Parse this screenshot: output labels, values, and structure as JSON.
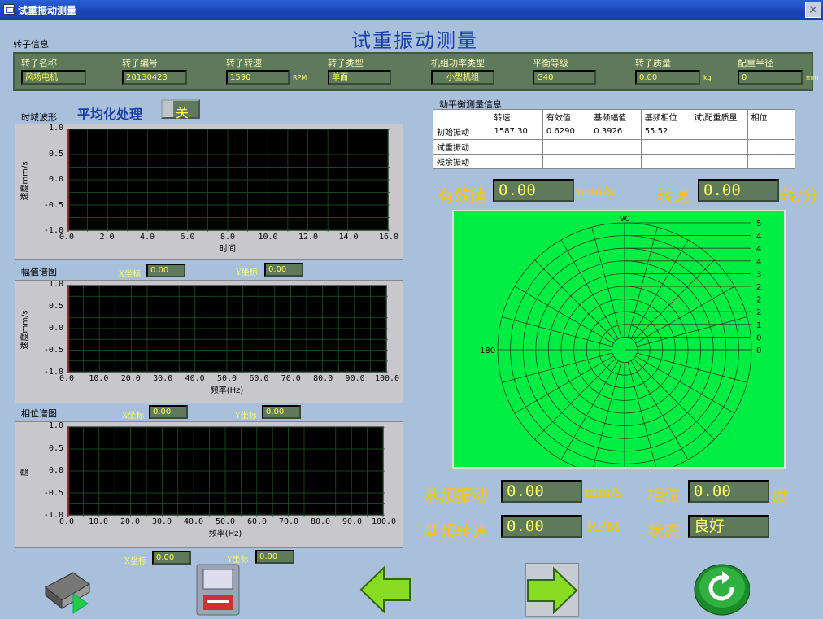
{
  "window": {
    "title": "试重振动测量"
  },
  "header": {
    "title": "试重振动测量",
    "section_label": "转子信息"
  },
  "rotor_info": [
    {
      "label": "转子名称",
      "value": "风场电机",
      "unit": ""
    },
    {
      "label": "转子编号",
      "value": "20130423",
      "unit": ""
    },
    {
      "label": "转子转速",
      "value": "1590",
      "unit": "RPM"
    },
    {
      "label": "转子类型",
      "value": "单面",
      "unit": ""
    },
    {
      "label": "机组功率类型",
      "value": "小型机组",
      "unit": ""
    },
    {
      "label": "平衡等级",
      "value": "G40",
      "unit": ""
    },
    {
      "label": "转子质量",
      "value": "0.00",
      "unit": "kg"
    },
    {
      "label": "配重半径",
      "value": "0",
      "unit": "mm"
    }
  ],
  "averaging": {
    "label": "平均化处理",
    "value": "关"
  },
  "time_chart": {
    "title": "时域波形",
    "ylabel": "速度mm/s",
    "xlabel": "时间",
    "yticks": [
      "1.0",
      "0.5",
      "0.0",
      "-0.5",
      "-1.0"
    ],
    "xticks": [
      "0.0",
      "2.0",
      "4.0",
      "6.0",
      "8.0",
      "10.0",
      "12.0",
      "14.0",
      "16.0"
    ]
  },
  "amp_chart": {
    "title": "幅值谱图",
    "ylabel": "速度mm/s",
    "xlabel": "频率(Hz)",
    "yticks": [
      "1.0",
      "0.5",
      "0.0",
      "-0.5",
      "-1.0"
    ],
    "xticks": [
      "0.0",
      "10.0",
      "20.0",
      "30.0",
      "40.0",
      "50.0",
      "60.0",
      "70.0",
      "80.0",
      "90.0",
      "100.0"
    ],
    "x_coord_label": "X坐标",
    "x_coord": "0.00",
    "y_coord_label": "Y坐标",
    "y_coord": "0.00"
  },
  "phase_chart": {
    "title": "相位谱图",
    "ylabel": "度",
    "xlabel": "频率(Hz)",
    "yticks": [
      "1.0",
      "0.5",
      "0.0",
      "-0.5",
      "-1.0"
    ],
    "xticks": [
      "0.0",
      "10.0",
      "20.0",
      "30.0",
      "40.0",
      "50.0",
      "60.0",
      "70.0",
      "80.0",
      "90.0",
      "100.0"
    ],
    "x_coord_label": "X坐标",
    "x_coord": "0.00",
    "y_coord_label": "Y坐标",
    "y_coord": "0.00"
  },
  "bottom_coords": {
    "x_label": "X坐标",
    "x": "0.00",
    "y_label": "Y坐标",
    "y": "0.00"
  },
  "table": {
    "title": "动平衡测量信息",
    "headers": [
      "",
      "转速",
      "有效值",
      "基频幅值",
      "基频相位",
      "试\\配重质量",
      "相位"
    ],
    "rows": [
      [
        "初始振动",
        "1587.30",
        "0.6290",
        "0.3926",
        "55.52",
        "",
        ""
      ],
      [
        "试重振动",
        "",
        "",
        "",
        "",
        "",
        ""
      ],
      [
        "残余振动",
        "",
        "",
        "",
        "",
        "",
        ""
      ]
    ]
  },
  "readouts": {
    "rms_label": "有效值",
    "rms": "0.00",
    "rms_unit": "mm/s",
    "speed_label": "转速",
    "speed": "0.00",
    "speed_unit": "转/分",
    "fund_label": "基频振动",
    "fund": "0.00",
    "fund_unit": "mm/s",
    "phase_label": "相位",
    "phase": "0.00",
    "phase_unit": "度",
    "fspeed_label": "基频转速",
    "fspeed": "0.00",
    "fspeed_unit": "RPM",
    "state_label": "状态",
    "state": "良好"
  },
  "polar": {
    "top_label": "90",
    "left_label": "180",
    "ring_labels": [
      "5",
      "4",
      "4",
      "4",
      "3",
      "2",
      "2",
      "2",
      "1",
      "0",
      "0"
    ]
  },
  "buttons": [
    "rotor-transfer-icon",
    "save-disk-icon",
    "back-arrow-icon",
    "forward-arrow-icon",
    "return-icon"
  ]
}
